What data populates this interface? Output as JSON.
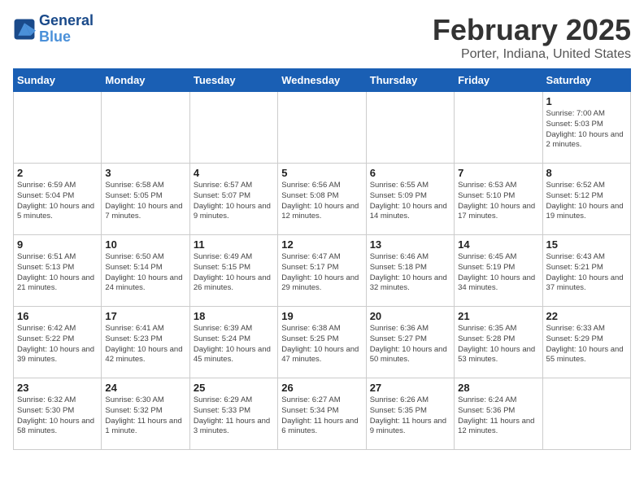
{
  "header": {
    "logo_line1": "General",
    "logo_line2": "Blue",
    "title": "February 2025",
    "subtitle": "Porter, Indiana, United States"
  },
  "days_of_week": [
    "Sunday",
    "Monday",
    "Tuesday",
    "Wednesday",
    "Thursday",
    "Friday",
    "Saturday"
  ],
  "weeks": [
    [
      {
        "day": "",
        "info": ""
      },
      {
        "day": "",
        "info": ""
      },
      {
        "day": "",
        "info": ""
      },
      {
        "day": "",
        "info": ""
      },
      {
        "day": "",
        "info": ""
      },
      {
        "day": "",
        "info": ""
      },
      {
        "day": "1",
        "info": "Sunrise: 7:00 AM\nSunset: 5:03 PM\nDaylight: 10 hours and 2 minutes."
      }
    ],
    [
      {
        "day": "2",
        "info": "Sunrise: 6:59 AM\nSunset: 5:04 PM\nDaylight: 10 hours and 5 minutes."
      },
      {
        "day": "3",
        "info": "Sunrise: 6:58 AM\nSunset: 5:05 PM\nDaylight: 10 hours and 7 minutes."
      },
      {
        "day": "4",
        "info": "Sunrise: 6:57 AM\nSunset: 5:07 PM\nDaylight: 10 hours and 9 minutes."
      },
      {
        "day": "5",
        "info": "Sunrise: 6:56 AM\nSunset: 5:08 PM\nDaylight: 10 hours and 12 minutes."
      },
      {
        "day": "6",
        "info": "Sunrise: 6:55 AM\nSunset: 5:09 PM\nDaylight: 10 hours and 14 minutes."
      },
      {
        "day": "7",
        "info": "Sunrise: 6:53 AM\nSunset: 5:10 PM\nDaylight: 10 hours and 17 minutes."
      },
      {
        "day": "8",
        "info": "Sunrise: 6:52 AM\nSunset: 5:12 PM\nDaylight: 10 hours and 19 minutes."
      }
    ],
    [
      {
        "day": "9",
        "info": "Sunrise: 6:51 AM\nSunset: 5:13 PM\nDaylight: 10 hours and 21 minutes."
      },
      {
        "day": "10",
        "info": "Sunrise: 6:50 AM\nSunset: 5:14 PM\nDaylight: 10 hours and 24 minutes."
      },
      {
        "day": "11",
        "info": "Sunrise: 6:49 AM\nSunset: 5:15 PM\nDaylight: 10 hours and 26 minutes."
      },
      {
        "day": "12",
        "info": "Sunrise: 6:47 AM\nSunset: 5:17 PM\nDaylight: 10 hours and 29 minutes."
      },
      {
        "day": "13",
        "info": "Sunrise: 6:46 AM\nSunset: 5:18 PM\nDaylight: 10 hours and 32 minutes."
      },
      {
        "day": "14",
        "info": "Sunrise: 6:45 AM\nSunset: 5:19 PM\nDaylight: 10 hours and 34 minutes."
      },
      {
        "day": "15",
        "info": "Sunrise: 6:43 AM\nSunset: 5:21 PM\nDaylight: 10 hours and 37 minutes."
      }
    ],
    [
      {
        "day": "16",
        "info": "Sunrise: 6:42 AM\nSunset: 5:22 PM\nDaylight: 10 hours and 39 minutes."
      },
      {
        "day": "17",
        "info": "Sunrise: 6:41 AM\nSunset: 5:23 PM\nDaylight: 10 hours and 42 minutes."
      },
      {
        "day": "18",
        "info": "Sunrise: 6:39 AM\nSunset: 5:24 PM\nDaylight: 10 hours and 45 minutes."
      },
      {
        "day": "19",
        "info": "Sunrise: 6:38 AM\nSunset: 5:25 PM\nDaylight: 10 hours and 47 minutes."
      },
      {
        "day": "20",
        "info": "Sunrise: 6:36 AM\nSunset: 5:27 PM\nDaylight: 10 hours and 50 minutes."
      },
      {
        "day": "21",
        "info": "Sunrise: 6:35 AM\nSunset: 5:28 PM\nDaylight: 10 hours and 53 minutes."
      },
      {
        "day": "22",
        "info": "Sunrise: 6:33 AM\nSunset: 5:29 PM\nDaylight: 10 hours and 55 minutes."
      }
    ],
    [
      {
        "day": "23",
        "info": "Sunrise: 6:32 AM\nSunset: 5:30 PM\nDaylight: 10 hours and 58 minutes."
      },
      {
        "day": "24",
        "info": "Sunrise: 6:30 AM\nSunset: 5:32 PM\nDaylight: 11 hours and 1 minute."
      },
      {
        "day": "25",
        "info": "Sunrise: 6:29 AM\nSunset: 5:33 PM\nDaylight: 11 hours and 3 minutes."
      },
      {
        "day": "26",
        "info": "Sunrise: 6:27 AM\nSunset: 5:34 PM\nDaylight: 11 hours and 6 minutes."
      },
      {
        "day": "27",
        "info": "Sunrise: 6:26 AM\nSunset: 5:35 PM\nDaylight: 11 hours and 9 minutes."
      },
      {
        "day": "28",
        "info": "Sunrise: 6:24 AM\nSunset: 5:36 PM\nDaylight: 11 hours and 12 minutes."
      },
      {
        "day": "",
        "info": ""
      }
    ]
  ]
}
